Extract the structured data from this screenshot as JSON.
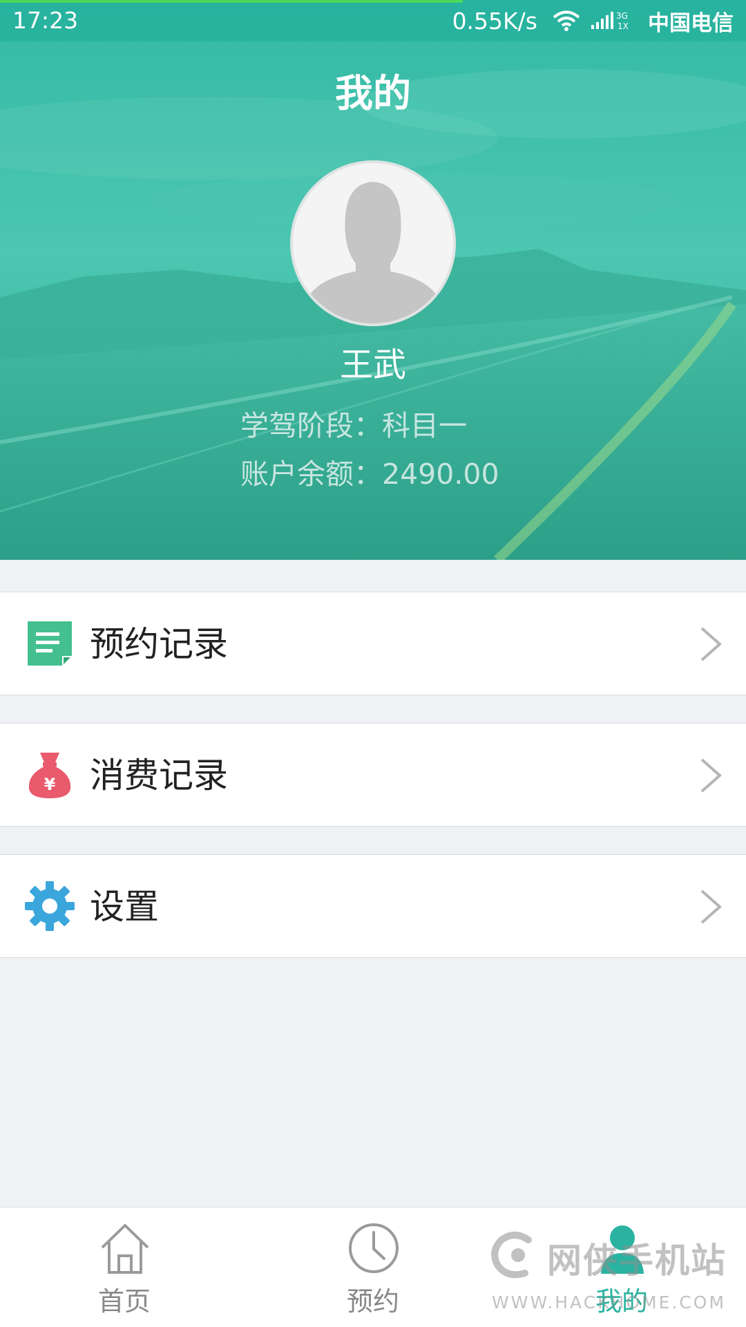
{
  "status_bar": {
    "time": "17:23",
    "network_speed": "0.55K/s",
    "signal_type_top": "3G",
    "signal_type_bottom": "1X",
    "carrier": "中国电信"
  },
  "header": {
    "title": "我的"
  },
  "profile": {
    "name": "王武",
    "stage": "学驾阶段：科目一",
    "balance": "账户余额：2490.00"
  },
  "menu": [
    {
      "label": "预约记录",
      "icon": "document-icon",
      "color": "#43c08e"
    },
    {
      "label": "消费记录",
      "icon": "money-bag-icon",
      "color": "#e85a6c"
    },
    {
      "label": "设置",
      "icon": "gear-icon",
      "color": "#3aa6dc"
    }
  ],
  "bottom_nav": [
    {
      "label": "首页",
      "icon": "home-icon",
      "active": false
    },
    {
      "label": "预约",
      "icon": "clock-icon",
      "active": false
    },
    {
      "label": "我的",
      "icon": "person-icon",
      "active": true
    }
  ],
  "watermark": {
    "cn": "网侠手机站",
    "en": "WWW.HACKHOME.COM"
  },
  "colors": {
    "accent": "#2ab3a0",
    "hero": "#3cc2ab",
    "background": "#eff1f5"
  }
}
